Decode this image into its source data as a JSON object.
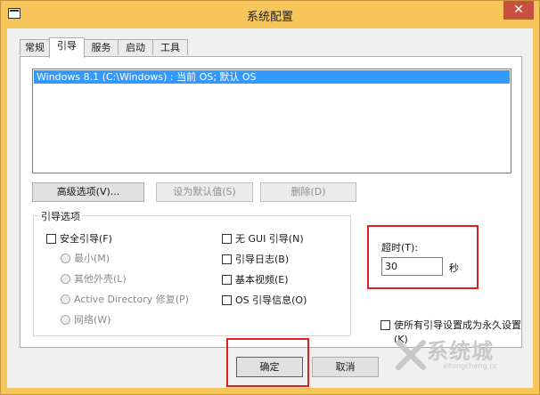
{
  "window": {
    "title": "系统配置",
    "close_glyph": "✕"
  },
  "tabs": [
    {
      "label": "常规",
      "active": false
    },
    {
      "label": "引导",
      "active": true
    },
    {
      "label": "服务",
      "active": false
    },
    {
      "label": "启动",
      "active": false
    },
    {
      "label": "工具",
      "active": false
    }
  ],
  "boot_list": {
    "entries": [
      "Windows 8.1 (C:\\Windows) : 当前 OS; 默认 OS"
    ]
  },
  "actions": {
    "advanced": "高级选项(V)...",
    "set_default": "设为默认值(S)",
    "delete": "删除(D)"
  },
  "boot_options": {
    "legend": "引导选项",
    "safe_boot": "安全引导(F)",
    "minimal": "最小(M)",
    "alternate_shell": "其他外壳(L)",
    "active_directory": "Active Directory 修复(P)",
    "network": "网络(W)",
    "no_gui": "无 GUI 引导(N)",
    "boot_log": "引导日志(B)",
    "base_video": "基本视频(E)",
    "os_boot_info": "OS 引导信息(O)"
  },
  "timeout": {
    "label": "超时(T):",
    "value": "30",
    "unit": "秒"
  },
  "permanent": {
    "line1": "使所有引导设置成为永久设置",
    "line2": "(K)"
  },
  "footer": {
    "ok": "确定",
    "cancel": "取消"
  },
  "watermark": {
    "text": "系统城",
    "url": "xitongcheng.cc"
  },
  "colors": {
    "title_bar": "#f6c65a",
    "selection": "#3399ff",
    "close_button": "#c7503f",
    "annotation": "#e02020"
  }
}
